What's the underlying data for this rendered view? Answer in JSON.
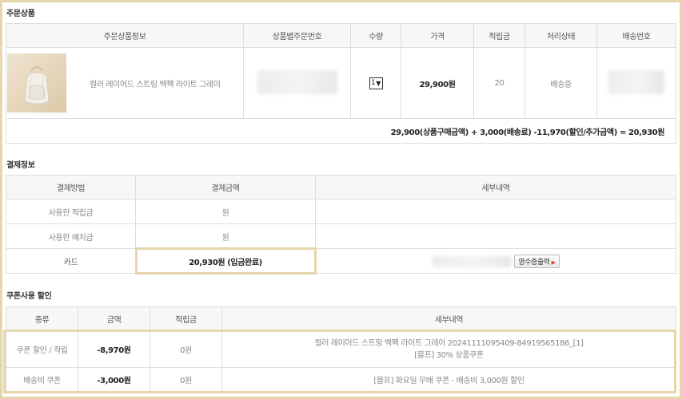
{
  "order_section": {
    "title": "주문상품",
    "headers": [
      "주문상품정보",
      "상품별주문번호",
      "수량",
      "가격",
      "적립금",
      "처리상태",
      "배송번호"
    ],
    "item": {
      "name": "컬러 레이어드 스트링 백팩 라이트 그레이",
      "quantity": "1",
      "price": "29,900원",
      "points": "20",
      "status": "배송중"
    },
    "summary": "29,900(상품구매금액) + 3,000(배송료) -11,970(할인/추가금액) = 20,930원"
  },
  "payment_section": {
    "title": "결제정보",
    "headers": [
      "결제방법",
      "결제금액",
      "세부내역"
    ],
    "rows": [
      {
        "method": "사용한 적립금",
        "amount": "원"
      },
      {
        "method": "사용한 예치금",
        "amount": "원"
      },
      {
        "method": "카드",
        "amount": "20,930원 (입금완료)",
        "receipt_button": "영수증출력"
      }
    ]
  },
  "coupon_section": {
    "title": "쿠폰사용 할인",
    "headers": [
      "종류",
      "금액",
      "적립금",
      "세부내역"
    ],
    "rows": [
      {
        "type": "쿠폰 할인 / 적립",
        "amount": "-8,970원",
        "points": "0원",
        "detail_line1": "컬러 레이어드 스트링 백팩 라이트 그레이 20241111095409-84919565186_[1]",
        "detail_line2": "[블프] 30% 상품쿠폰"
      },
      {
        "type": "배송비 쿠폰",
        "amount": "-3,000원",
        "points": "0원",
        "detail_line1": "[블프] 화요일 무배 쿠폰 - 배송비 3,000원 할인"
      }
    ]
  },
  "colors": {
    "highlight": "#e6d6ac",
    "header_bg": "#f7f7f7",
    "border": "#dddddd",
    "receipt_arrow": "#d84a1b"
  }
}
